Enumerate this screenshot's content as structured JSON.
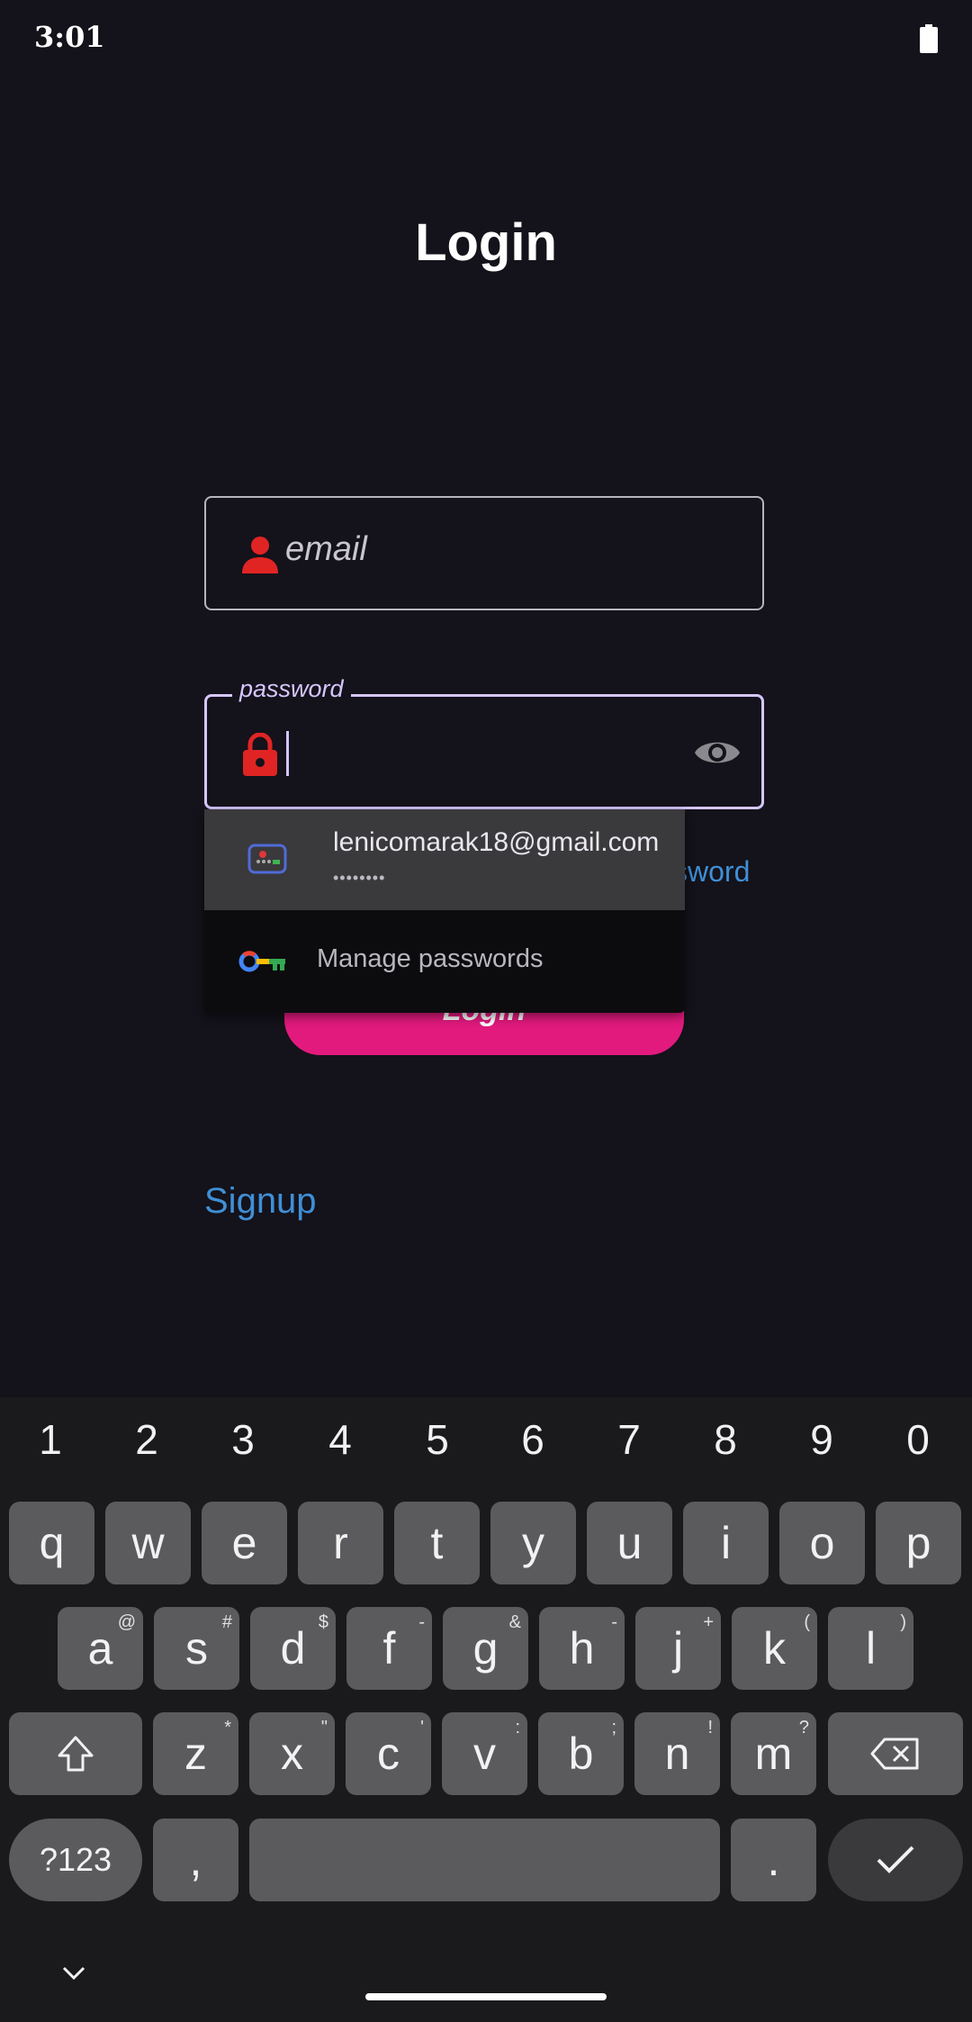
{
  "status_bar": {
    "time": "3:01",
    "battery_icon": "battery-icon"
  },
  "page": {
    "title": "Login"
  },
  "email": {
    "placeholder": "email",
    "icon": "person-icon"
  },
  "password": {
    "label": "password",
    "icon": "lock-icon",
    "toggle_icon": "eye-icon"
  },
  "forgot_password": {
    "visible_text": "ssword"
  },
  "login_button": {
    "label": "Login"
  },
  "autofill": {
    "credential_email": "lenicomarak18@gmail.com",
    "credential_password_mask": "••••••••",
    "manage_label": "Manage passwords"
  },
  "signup": {
    "label": "Signup"
  },
  "keyboard": {
    "numbers": [
      "1",
      "2",
      "3",
      "4",
      "5",
      "6",
      "7",
      "8",
      "9",
      "0"
    ],
    "row1": [
      {
        "key": "q",
        "hint": ""
      },
      {
        "key": "w",
        "hint": ""
      },
      {
        "key": "e",
        "hint": ""
      },
      {
        "key": "r",
        "hint": ""
      },
      {
        "key": "t",
        "hint": ""
      },
      {
        "key": "y",
        "hint": ""
      },
      {
        "key": "u",
        "hint": ""
      },
      {
        "key": "i",
        "hint": ""
      },
      {
        "key": "o",
        "hint": ""
      },
      {
        "key": "p",
        "hint": ""
      }
    ],
    "row2": [
      {
        "key": "a",
        "hint": "@"
      },
      {
        "key": "s",
        "hint": "#"
      },
      {
        "key": "d",
        "hint": "$"
      },
      {
        "key": "f",
        "hint": "-"
      },
      {
        "key": "g",
        "hint": "&"
      },
      {
        "key": "h",
        "hint": "-"
      },
      {
        "key": "j",
        "hint": "+"
      },
      {
        "key": "k",
        "hint": "("
      },
      {
        "key": "l",
        "hint": ")"
      }
    ],
    "row3": [
      {
        "key": "z",
        "hint": "*"
      },
      {
        "key": "x",
        "hint": "\""
      },
      {
        "key": "c",
        "hint": "'"
      },
      {
        "key": "v",
        "hint": ":"
      },
      {
        "key": "b",
        "hint": ";"
      },
      {
        "key": "n",
        "hint": "!"
      },
      {
        "key": "m",
        "hint": "?"
      }
    ],
    "symbols_label": "?123",
    "comma": ",",
    "period": "."
  }
}
